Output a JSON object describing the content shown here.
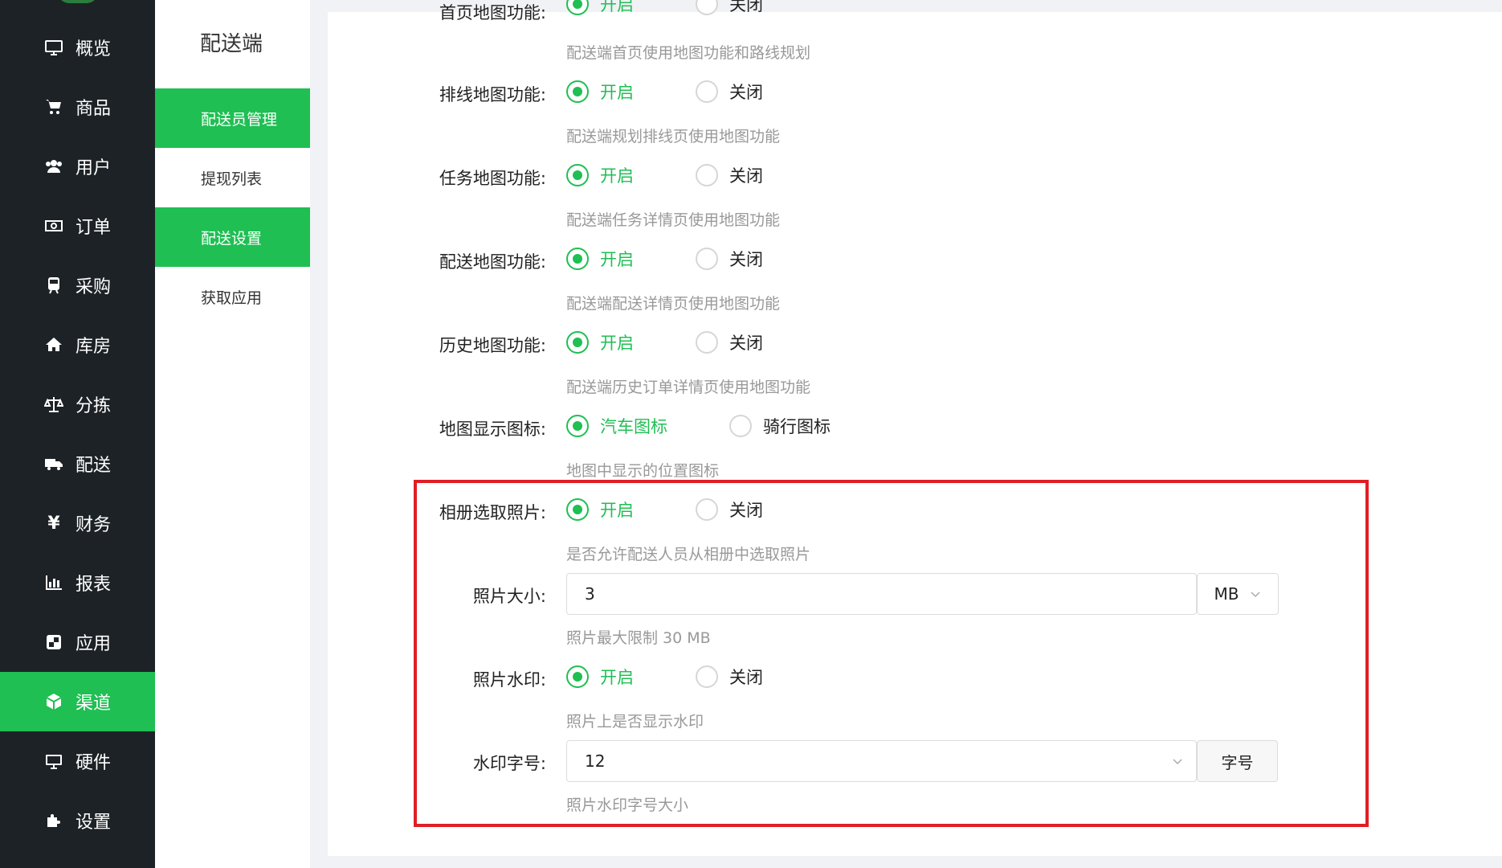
{
  "sidebar": {
    "items": [
      {
        "label": "概览",
        "icon": "monitor-icon"
      },
      {
        "label": "商品",
        "icon": "cart-icon"
      },
      {
        "label": "用户",
        "icon": "users-icon"
      },
      {
        "label": "订单",
        "icon": "money-icon"
      },
      {
        "label": "采购",
        "icon": "train-icon"
      },
      {
        "label": "库房",
        "icon": "home-icon"
      },
      {
        "label": "分拣",
        "icon": "scale-icon"
      },
      {
        "label": "配送",
        "icon": "truck-icon"
      },
      {
        "label": "财务",
        "icon": "yen-icon"
      },
      {
        "label": "报表",
        "icon": "bar-chart-icon"
      },
      {
        "label": "应用",
        "icon": "app-icon"
      },
      {
        "label": "渠道",
        "icon": "cube-icon",
        "active": true
      },
      {
        "label": "硬件",
        "icon": "desktop-icon"
      },
      {
        "label": "设置",
        "icon": "puzzle-icon"
      }
    ]
  },
  "subnav": {
    "title": "配送端",
    "items": [
      {
        "label": "配送员管理",
        "active": true
      },
      {
        "label": "提现列表"
      },
      {
        "label": "配送设置",
        "active": true
      },
      {
        "label": "获取应用"
      }
    ]
  },
  "form": {
    "partial_row": {
      "label": "首页地图功能:",
      "on": "开启",
      "off": "关闭"
    },
    "rows": [
      {
        "hint_above": "配送端首页使用地图功能和路线规划",
        "label": "排线地图功能:",
        "option_a": "开启",
        "option_b": "关闭"
      },
      {
        "hint_above": "配送端规划排线页使用地图功能",
        "label": "任务地图功能:",
        "option_a": "开启",
        "option_b": "关闭"
      },
      {
        "hint_above": "配送端任务详情页使用地图功能",
        "label": "配送地图功能:",
        "option_a": "开启",
        "option_b": "关闭"
      },
      {
        "hint_above": "配送端配送详情页使用地图功能",
        "label": "历史地图功能:",
        "option_a": "开启",
        "option_b": "关闭"
      },
      {
        "hint_above": "配送端历史订单详情页使用地图功能",
        "label": "地图显示图标:",
        "option_a": "汽车图标",
        "option_b": "骑行图标"
      }
    ],
    "icon_hint": "地图中显示的位置图标",
    "album": {
      "label": "相册选取照片:",
      "option_a": "开启",
      "option_b": "关闭",
      "hint": "是否允许配送人员从相册中选取照片"
    },
    "photo_size": {
      "label": "照片大小:",
      "value": "3",
      "unit": "MB",
      "hint": "照片最大限制 30 MB"
    },
    "watermark": {
      "label": "照片水印:",
      "option_a": "开启",
      "option_b": "关闭",
      "hint": "照片上是否显示水印"
    },
    "font_size": {
      "label": "水印字号:",
      "value": "12",
      "addon": "字号",
      "hint": "照片水印字号大小"
    }
  },
  "colors": {
    "accent": "#1fbf53",
    "sidebar": "#1d2226",
    "highlight": "#e01e24"
  }
}
